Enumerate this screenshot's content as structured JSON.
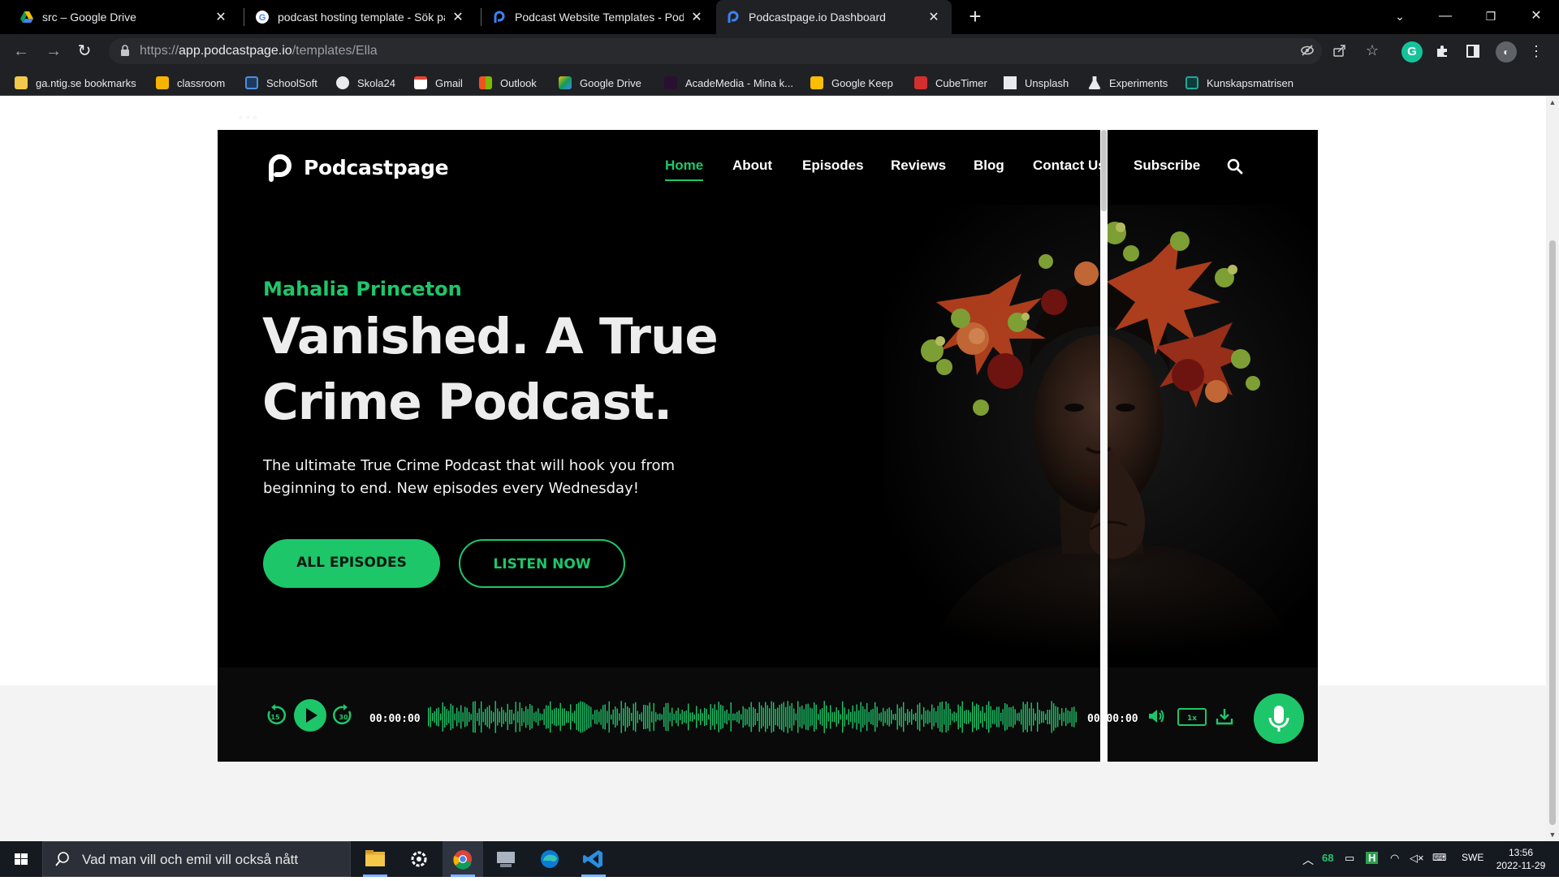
{
  "browser": {
    "tabs": [
      {
        "title": "src – Google Drive",
        "favicon": "google-drive-icon",
        "active": false
      },
      {
        "title": "podcast hosting template - Sök på G",
        "favicon": "google-icon",
        "active": false
      },
      {
        "title": "Podcast Website Templates - Podcas",
        "favicon": "podcastpage-icon",
        "active": false
      },
      {
        "title": "Podcastpage.io Dashboard",
        "favicon": "podcastpage-icon",
        "active": true
      }
    ],
    "url_prefix": "https://",
    "url_domain": "app.podcastpage.io",
    "url_path": "/templates/Ella",
    "bookmarks": [
      {
        "label": "ga.ntig.se bookmarks",
        "icon": "folder-icon",
        "color": "#f2c94c"
      },
      {
        "label": "classroom",
        "icon": "classroom-icon",
        "color": "#f4b400"
      },
      {
        "label": "SchoolSoft",
        "icon": "schoolsoft-icon",
        "color": "#4a90e2"
      },
      {
        "label": "Skola24",
        "icon": "globe-icon",
        "color": "#e8eaed"
      },
      {
        "label": "Gmail",
        "icon": "gmail-icon",
        "color": "#ea4335"
      },
      {
        "label": "Outlook",
        "icon": "microsoft-icon",
        "color": "#f25022"
      },
      {
        "label": "Google Drive",
        "icon": "google-drive-icon",
        "color": "#0f9d58"
      },
      {
        "label": "AcadeMedia - Mina k...",
        "icon": "academedia-icon",
        "color": "#6a1b9a"
      },
      {
        "label": "Google Keep",
        "icon": "keep-icon",
        "color": "#fbbc04"
      },
      {
        "label": "CubeTimer",
        "icon": "cubetimer-icon",
        "color": "#d32f2f"
      },
      {
        "label": "Unsplash",
        "icon": "unsplash-icon",
        "color": "#e8eaed"
      },
      {
        "label": "Experiments",
        "icon": "flask-icon",
        "color": "#e8eaed"
      },
      {
        "label": "Kunskapsmatrisen",
        "icon": "matrix-icon",
        "color": "#26a69a"
      }
    ]
  },
  "site": {
    "brand": "Podcastpage",
    "nav": [
      "Home",
      "About",
      "Episodes",
      "Reviews",
      "Blog",
      "Contact Us",
      "Subscribe"
    ],
    "active_nav": "Home",
    "host": "Mahalia Princeton",
    "headline": "Vanished. A True Crime Podcast.",
    "lead": "The ultimate True Crime Podcast that will hook you from beginning to end. New episodes every Wednesday!",
    "btn_primary": "ALL EPISODES",
    "btn_secondary": "LISTEN NOW",
    "accent": "#1ec66a"
  },
  "player": {
    "time_current": "00:00:00",
    "time_total": "00:00:00",
    "rewind_label": "15",
    "forward_label": "30",
    "speed_label": "1x",
    "progress": 0
  },
  "taskbar": {
    "search_placeholder": "Vad man vill och emil vill också nått",
    "tray_number": "68",
    "lang": "SWE",
    "time": "13:56",
    "date": "2022-11-29"
  }
}
